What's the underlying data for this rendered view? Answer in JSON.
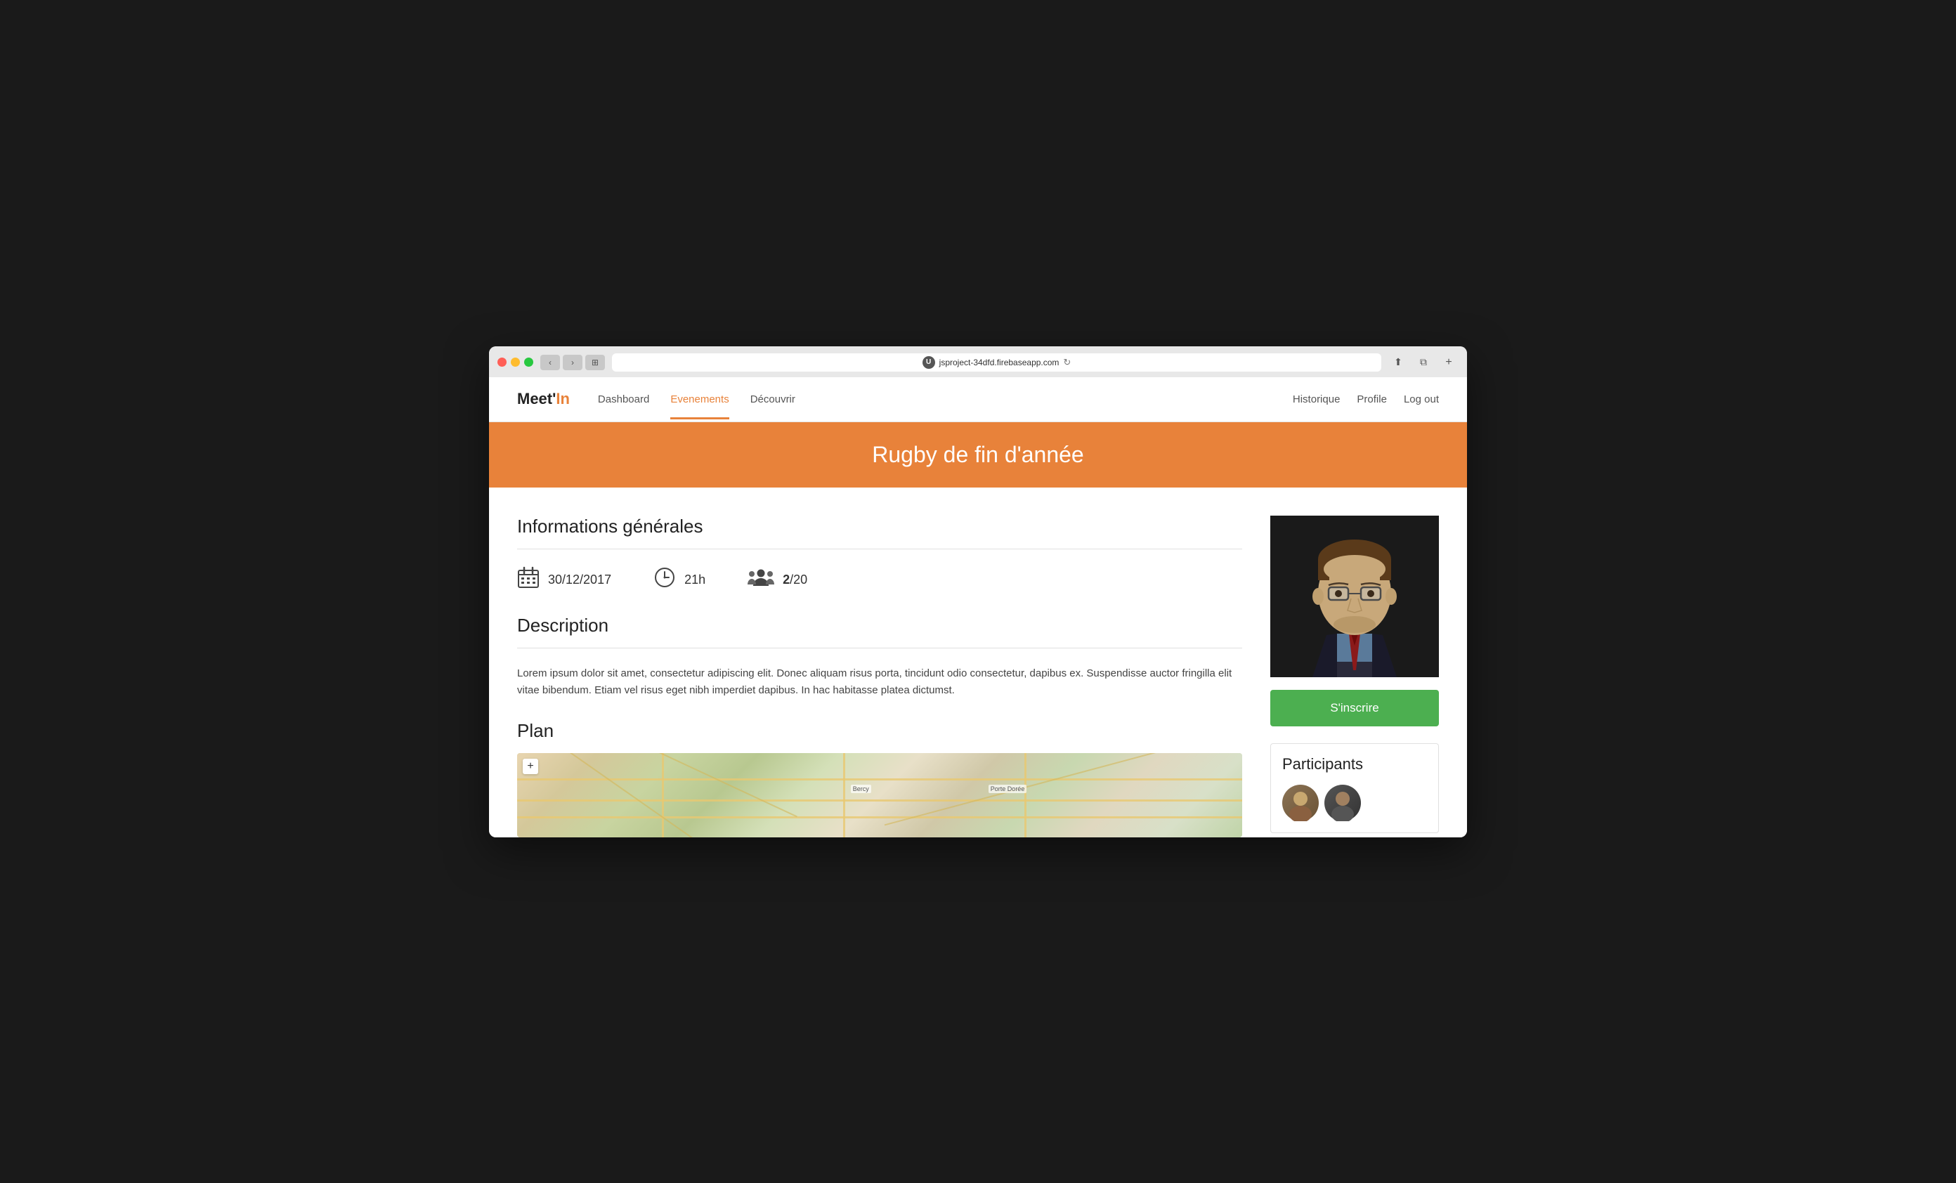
{
  "browser": {
    "url": "jsproject-34dfd.firebaseapp.com",
    "tab_plus_label": "+",
    "back_arrow": "‹",
    "forward_arrow": "›",
    "user_initial": "U",
    "refresh_icon": "↻"
  },
  "nav": {
    "logo": "Meet'In",
    "logo_highlight": "In",
    "links": [
      {
        "label": "Dashboard",
        "active": false
      },
      {
        "label": "Evenements",
        "active": true
      },
      {
        "label": "Découvrir",
        "active": false
      }
    ],
    "right_links": [
      {
        "label": "Historique"
      },
      {
        "label": "Profile"
      },
      {
        "label": "Log out"
      }
    ]
  },
  "hero": {
    "title": "Rugby de fin d'année",
    "bg_color": "#e8823a"
  },
  "event": {
    "info_section_title": "Informations générales",
    "date": "30/12/2017",
    "time": "21h",
    "capacity": "2/20",
    "capacity_bold": "2",
    "capacity_rest": "/20",
    "description_title": "Description",
    "description_text": "Lorem ipsum dolor sit amet, consectetur adipiscing elit. Donec aliquam risus porta, tincidunt odio consectetur, dapibus ex. Suspendisse auctor fringilla elit vitae bibendum. Etiam vel risus eget nibh imperdiet dapibus. In hac habitasse platea dictumst.",
    "plan_title": "Plan",
    "map_plus_label": "+",
    "map_label_bercy": "Bercy",
    "map_label_porte_doree": "Porte Dorée"
  },
  "sidebar": {
    "register_button_label": "S'inscrire",
    "register_button_color": "#4caf50",
    "participants_title": "Participants"
  },
  "colors": {
    "accent_orange": "#e8823a",
    "green": "#4caf50",
    "nav_active": "#e8823a"
  }
}
